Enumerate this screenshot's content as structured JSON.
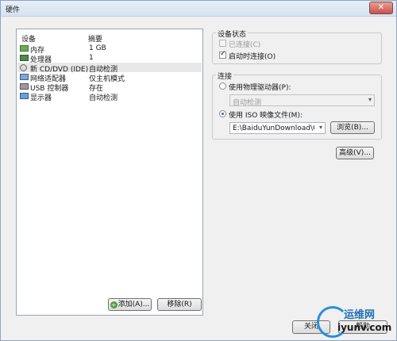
{
  "window": {
    "title": "硬件",
    "close_glyph": "✕"
  },
  "device_list": {
    "columns": [
      "设备",
      "摘要"
    ],
    "items": [
      {
        "icon": "memory-icon",
        "name": "内存",
        "summary": "1 GB"
      },
      {
        "icon": "cpu-icon",
        "name": "处理器",
        "summary": "1"
      },
      {
        "icon": "cd-drive-icon",
        "name": "新 CD/DVD (IDE)",
        "summary": "自动检测",
        "selected": true
      },
      {
        "icon": "network-adapter-icon",
        "name": "网络适配器",
        "summary": "仅主机模式"
      },
      {
        "icon": "usb-icon",
        "name": "USB 控制器",
        "summary": "存在"
      },
      {
        "icon": "display-icon",
        "name": "显示器",
        "summary": "自动检测"
      }
    ]
  },
  "device_buttons": {
    "add": "添加(A)...",
    "remove": "移除(R)"
  },
  "device_status": {
    "title": "设备状态",
    "connected": {
      "label": "已连接(C)",
      "checked": false,
      "enabled": false
    },
    "connect_on_power": {
      "label": "启动时连接(O)",
      "checked": true
    }
  },
  "connection": {
    "title": "连接",
    "physical": {
      "label": "使用物理驱动器(P):",
      "selected": false,
      "combo_value": "自动检测"
    },
    "iso": {
      "label": "使用 ISO 映像文件(M):",
      "selected": true,
      "path_value": "E:\\BaiduYunDownload\\Cent",
      "browse": "浏览(B)..."
    }
  },
  "advanced_button": "高级(V)...",
  "footer": {
    "close": "关闭",
    "help": "帮助"
  },
  "watermark": {
    "line1": "运维网",
    "line2": "iyunv.com"
  }
}
